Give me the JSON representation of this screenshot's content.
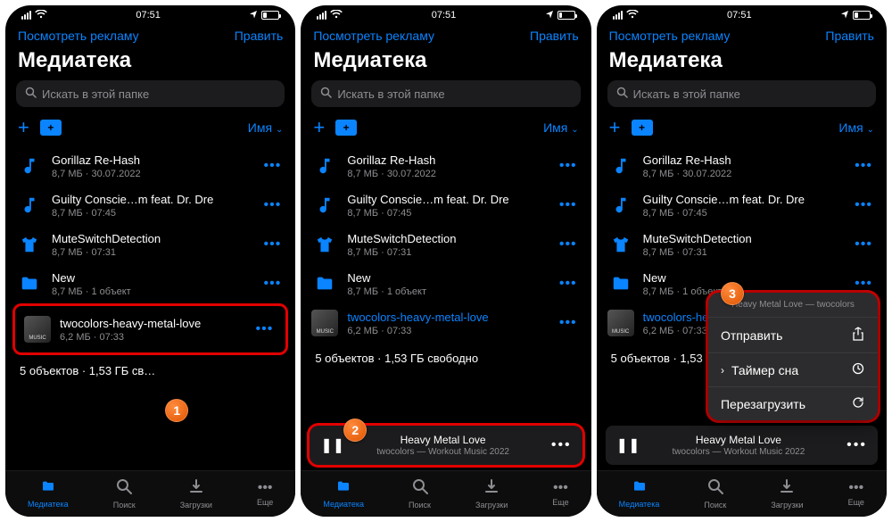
{
  "status": {
    "time": "07:51"
  },
  "nav": {
    "left": "Посмотреть рекламу",
    "right": "Править"
  },
  "title": "Медиатека",
  "search": {
    "placeholder": "Искать в этой папке"
  },
  "sort": "Имя",
  "items": [
    {
      "name": "Gorillaz Re-Hash",
      "sub": "8,7 МБ · 30.07.2022",
      "icon": "music"
    },
    {
      "name": "Guilty Conscie…m feat. Dr. Dre",
      "sub": "8,7 МБ · 07:45",
      "icon": "music"
    },
    {
      "name": "MuteSwitchDetection",
      "sub": "8,7 МБ · 07:31",
      "icon": "shirt"
    },
    {
      "name": "New",
      "sub": "8,7 МБ · 1 объект",
      "icon": "folder"
    },
    {
      "name": "twocolors-heavy-metal-love",
      "sub": "6,2 МБ · 07:33",
      "icon": "album"
    }
  ],
  "summary": "5 объектов  ·  1,53 ГБ свободно",
  "summary_short": "5 объектов  ·  1,53 ГБ св…",
  "player": {
    "title": "Heavy Metal Love",
    "sub": "twocolors — Workout Music 2022"
  },
  "popup": {
    "head": "Heavy Metal Love — twocolors",
    "send": "Отправить",
    "timer": "Таймер сна",
    "reload": "Перезагрузить"
  },
  "tabs": {
    "library": "Медиатека",
    "search": "Поиск",
    "downloads": "Загрузки",
    "more": "Еще"
  },
  "callouts": {
    "c1": "1",
    "c2": "2",
    "c3": "3"
  }
}
